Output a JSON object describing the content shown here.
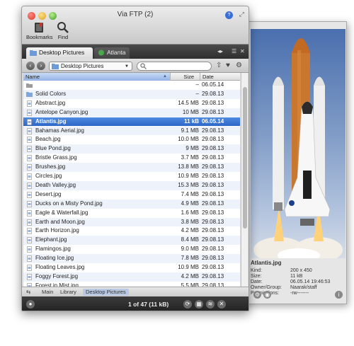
{
  "window": {
    "title": "Via FTP (2)",
    "badge": "?",
    "toolbar": {
      "bookmarks_label": "Bookmarks",
      "find_label": "Find"
    }
  },
  "tabs": [
    {
      "label": "Desktop Pictures",
      "active": true
    },
    {
      "label": "Atlanta",
      "active": false
    }
  ],
  "pathbar": {
    "current_folder": "Desktop Pictures",
    "search_placeholder": ""
  },
  "columns": {
    "name": "Name",
    "size": "Size",
    "date": "Date"
  },
  "files": [
    {
      "name": "",
      "size": "–",
      "date": "06.05.14",
      "icon": "parent-folder",
      "selected": false
    },
    {
      "name": "Solid Colors",
      "size": "–",
      "date": "29.08.13",
      "icon": "folder",
      "selected": false
    },
    {
      "name": "Abstract.jpg",
      "size": "14.5 MB",
      "date": "29.08.13",
      "icon": "file",
      "selected": false
    },
    {
      "name": "Antelope Canyon.jpg",
      "size": "10 MB",
      "date": "29.08.13",
      "icon": "file",
      "selected": false
    },
    {
      "name": "Atlantis.jpg",
      "size": "11 kB",
      "date": "06.05.14",
      "icon": "file",
      "selected": true
    },
    {
      "name": "Bahamas Aerial.jpg",
      "size": "9.1 MB",
      "date": "29.08.13",
      "icon": "file",
      "selected": false
    },
    {
      "name": "Beach.jpg",
      "size": "10.0 MB",
      "date": "29.08.13",
      "icon": "file",
      "selected": false
    },
    {
      "name": "Blue Pond.jpg",
      "size": "9 MB",
      "date": "29.08.13",
      "icon": "file",
      "selected": false
    },
    {
      "name": "Bristle Grass.jpg",
      "size": "3.7 MB",
      "date": "29.08.13",
      "icon": "file",
      "selected": false
    },
    {
      "name": "Brushes.jpg",
      "size": "13.8 MB",
      "date": "29.08.13",
      "icon": "file",
      "selected": false
    },
    {
      "name": "Circles.jpg",
      "size": "10.9 MB",
      "date": "29.08.13",
      "icon": "file",
      "selected": false
    },
    {
      "name": "Death Valley.jpg",
      "size": "15.3 MB",
      "date": "29.08.13",
      "icon": "file",
      "selected": false
    },
    {
      "name": "Desert.jpg",
      "size": "7.4 MB",
      "date": "29.08.13",
      "icon": "file",
      "selected": false
    },
    {
      "name": "Ducks on a Misty Pond.jpg",
      "size": "4.9 MB",
      "date": "29.08.13",
      "icon": "file",
      "selected": false
    },
    {
      "name": "Eagle & Waterfall.jpg",
      "size": "1.6 MB",
      "date": "29.08.13",
      "icon": "file",
      "selected": false
    },
    {
      "name": "Earth and Moon.jpg",
      "size": "3.8 MB",
      "date": "29.08.13",
      "icon": "file",
      "selected": false
    },
    {
      "name": "Earth Horizon.jpg",
      "size": "4.2 MB",
      "date": "29.08.13",
      "icon": "file",
      "selected": false
    },
    {
      "name": "Elephant.jpg",
      "size": "8.4 MB",
      "date": "29.08.13",
      "icon": "file",
      "selected": false
    },
    {
      "name": "Flamingos.jpg",
      "size": "9.0 MB",
      "date": "29.08.13",
      "icon": "file",
      "selected": false
    },
    {
      "name": "Floating Ice.jpg",
      "size": "7.8 MB",
      "date": "29.08.13",
      "icon": "file",
      "selected": false
    },
    {
      "name": "Floating Leaves.jpg",
      "size": "10.9 MB",
      "date": "29.08.13",
      "icon": "file",
      "selected": false
    },
    {
      "name": "Foggy Forest.jpg",
      "size": "4.2 MB",
      "date": "29.08.13",
      "icon": "file",
      "selected": false
    },
    {
      "name": "Forest in Mist.jpg",
      "size": "5.5 MB",
      "date": "29.08.13",
      "icon": "file",
      "selected": false
    }
  ],
  "breadcrumbs": [
    "Main",
    "Library",
    "Desktop Pictures"
  ],
  "status": {
    "text": "1 of 47 (11 kB)"
  },
  "preview": {
    "name": "Atlantis.jpg",
    "fields": [
      {
        "key": "Kind:",
        "value": "200 x 450"
      },
      {
        "key": "Size:",
        "value": "11 kB"
      },
      {
        "key": "Date:",
        "value": "06.05.14 19:46:53"
      },
      {
        "key": "Owner/Group:",
        "value": "Naarak/staff"
      },
      {
        "key": "Permissions:",
        "value": "-rw-------"
      }
    ]
  },
  "colors": {
    "selection": "#2e66c8",
    "accent": "#3b6fd8",
    "statusbar": "#2b2b2b"
  }
}
